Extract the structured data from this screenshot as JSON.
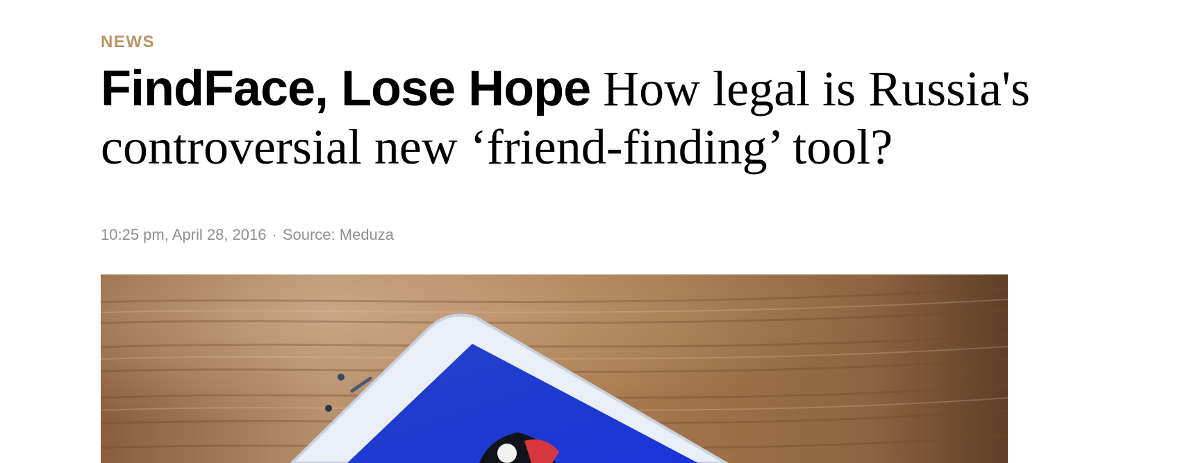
{
  "article": {
    "rubric": "NEWS",
    "headline_first": "FindFace, Lose Hope",
    "headline_second": "How legal is Russia's controversial new ‘friend-finding’ tool?",
    "meta": {
      "datetime": "10:25 pm, April 28, 2016",
      "separator": "·",
      "source": "Source: Meduza"
    },
    "hero_image": {
      "description_icon": "phone-on-table-photo"
    }
  },
  "colors": {
    "rubric": "#b89566",
    "meta": "#8f8f8f",
    "headline": "#000000",
    "screen_blue": "#1f3fd6",
    "table_wood": "#a9794d"
  }
}
